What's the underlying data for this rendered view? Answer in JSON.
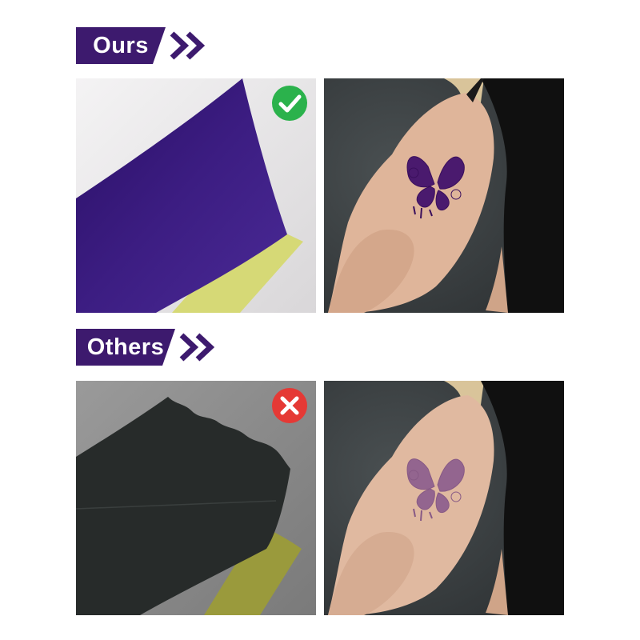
{
  "ours": {
    "label": "Ours",
    "badge": "check-icon",
    "badge_color": "#2bb24c"
  },
  "others": {
    "label": "Others",
    "badge": "x-icon",
    "badge_color": "#e53935"
  },
  "colors": {
    "brand_purple": "#3d1a6e",
    "paper_purple": "#3a1a7a",
    "paper_black": "#2b2f2e",
    "backing_yellow": "#d7d97a",
    "photo_bg": "#3a3f41"
  }
}
